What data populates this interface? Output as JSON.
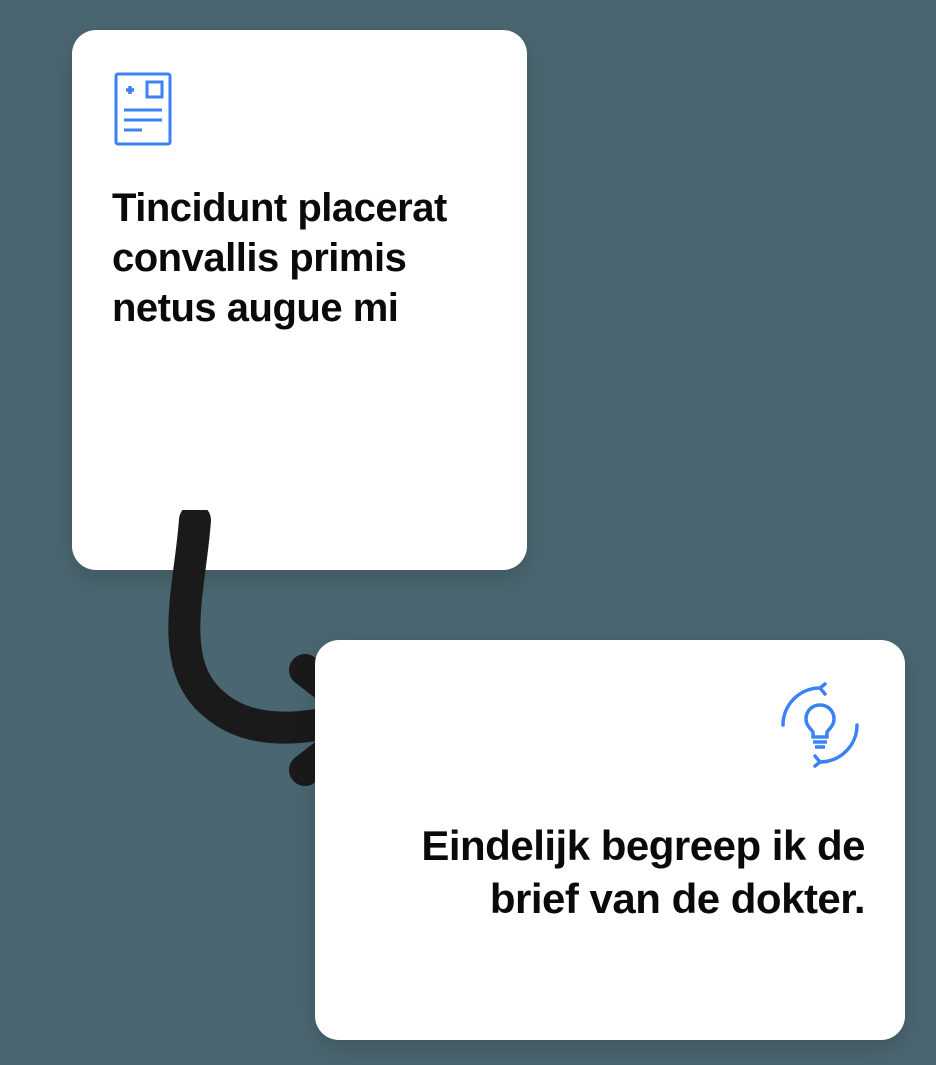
{
  "cards": {
    "top": {
      "title": "Tincidunt placerat convallis primis netus augue mi"
    },
    "bottom": {
      "title": "Eindelijk begreep ik de brief van de dokter."
    }
  },
  "colors": {
    "accent": "#3b82f6",
    "arrow": "#1a1a1a",
    "text": "#0a0a0a",
    "card_bg": "#ffffff",
    "page_bg": "#4a6670"
  }
}
